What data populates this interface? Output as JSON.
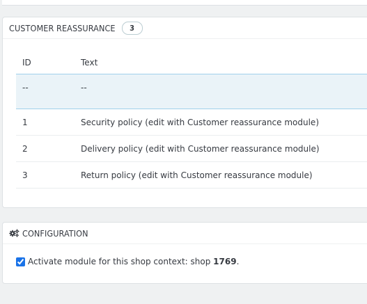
{
  "reassurance_panel": {
    "title": "CUSTOMER REASSURANCE",
    "count": "3",
    "columns": [
      "ID",
      "Text"
    ],
    "filter_row": {
      "id": "--",
      "text": "--"
    },
    "rows": [
      {
        "id": "1",
        "text": "Security policy (edit with Customer reassurance module)"
      },
      {
        "id": "2",
        "text": "Delivery policy (edit with Customer reassurance module)"
      },
      {
        "id": "3",
        "text": "Return policy (edit with Customer reassurance module)"
      }
    ]
  },
  "config_panel": {
    "title": "CONFIGURATION",
    "icon": "gears-icon",
    "checkbox_checked": true,
    "label_prefix": "Activate module for this shop context: shop ",
    "shop_id": "1769",
    "label_suffix": "."
  },
  "colors": {
    "background": "#eff1f2",
    "panel": "#ffffff",
    "filter_row": "#eaf3f8",
    "header_border": "#a0d0eb"
  }
}
